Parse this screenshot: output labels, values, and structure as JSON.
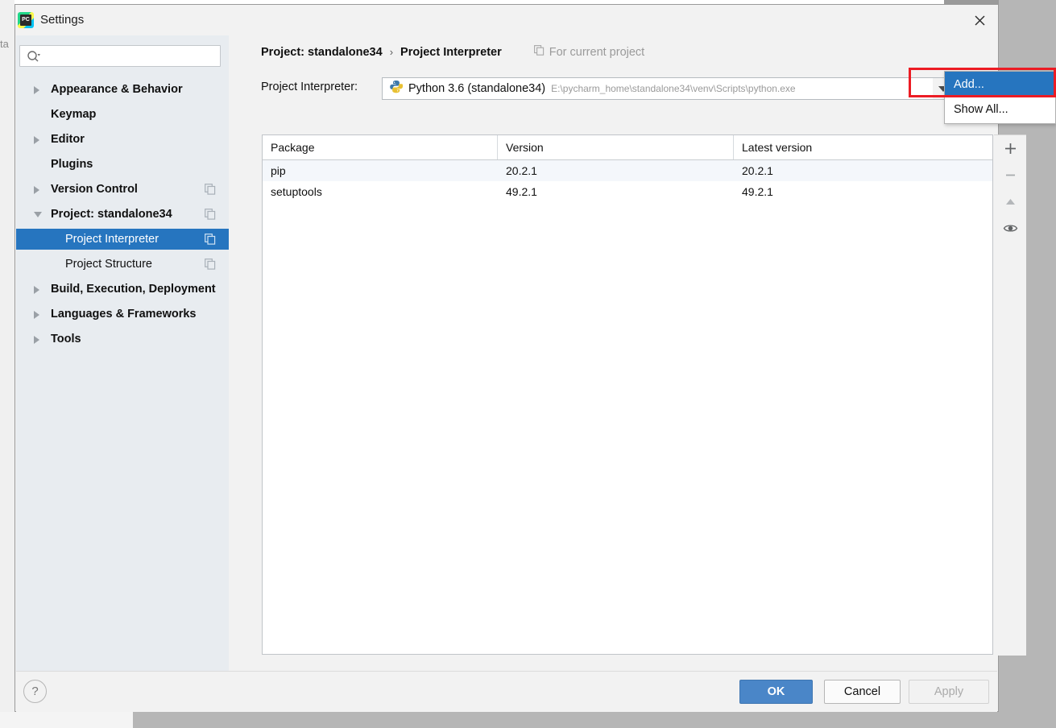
{
  "background": {
    "clipped_text": "ta"
  },
  "window": {
    "title": "Settings",
    "logo_icon": "pycharm-logo-icon",
    "close_icon": "close-icon"
  },
  "sidebar": {
    "search": {
      "placeholder": "",
      "value": "",
      "icon": "search-icon"
    },
    "items": [
      {
        "label": "Appearance & Behavior",
        "level": "top",
        "twisty": "collapsed",
        "selected": false,
        "copy_icon": false
      },
      {
        "label": "Keymap",
        "level": "top",
        "twisty": "none",
        "selected": false,
        "copy_icon": false
      },
      {
        "label": "Editor",
        "level": "top",
        "twisty": "collapsed",
        "selected": false,
        "copy_icon": false
      },
      {
        "label": "Plugins",
        "level": "top",
        "twisty": "none",
        "selected": false,
        "copy_icon": false
      },
      {
        "label": "Version Control",
        "level": "top",
        "twisty": "collapsed",
        "selected": false,
        "copy_icon": true
      },
      {
        "label": "Project: standalone34",
        "level": "top",
        "twisty": "expanded",
        "selected": false,
        "copy_icon": true
      },
      {
        "label": "Project Interpreter",
        "level": "child",
        "twisty": "none",
        "selected": true,
        "copy_icon": true
      },
      {
        "label": "Project Structure",
        "level": "child",
        "twisty": "none",
        "selected": false,
        "copy_icon": true
      },
      {
        "label": "Build, Execution, Deployment",
        "level": "top",
        "twisty": "collapsed",
        "selected": false,
        "copy_icon": false
      },
      {
        "label": "Languages & Frameworks",
        "level": "top",
        "twisty": "collapsed",
        "selected": false,
        "copy_icon": false
      },
      {
        "label": "Tools",
        "level": "top",
        "twisty": "collapsed",
        "selected": false,
        "copy_icon": false
      }
    ]
  },
  "main": {
    "breadcrumb": {
      "parent": "Project: standalone34",
      "separator": "›",
      "current": "Project Interpreter",
      "scope_label": "For current project",
      "scope_icon": "copy-scope-icon"
    },
    "interpreter": {
      "label": "Project Interpreter:",
      "icon": "python-icon",
      "name": "Python 3.6 (standalone34)",
      "path": "E:\\pycharm_home\\standalone34\\venv\\Scripts\\python.exe",
      "dropdown_icon": "chevron-down-icon"
    },
    "packages_table": {
      "columns": [
        "Package",
        "Version",
        "Latest version"
      ],
      "rows": [
        {
          "package": "pip",
          "version": "20.2.1",
          "latest": "20.2.1"
        },
        {
          "package": "setuptools",
          "version": "49.2.1",
          "latest": "49.2.1"
        }
      ]
    },
    "table_tools": [
      {
        "icon": "plus-icon",
        "name": "install-package-button"
      },
      {
        "icon": "minus-icon",
        "name": "uninstall-package-button"
      },
      {
        "icon": "arrow-up-icon",
        "name": "upgrade-package-button"
      },
      {
        "icon": "eye-icon",
        "name": "show-early-releases-button"
      }
    ]
  },
  "popup_menu": {
    "items": [
      {
        "label": "Add...",
        "active": true
      },
      {
        "label": "Show All...",
        "active": false
      }
    ]
  },
  "footer": {
    "help_label": "?",
    "ok_label": "OK",
    "cancel_label": "Cancel",
    "apply_label": "Apply"
  },
  "colors": {
    "accent_blue": "#2675bf",
    "ok_button": "#4a86c8",
    "highlight_red": "#ec1c24",
    "sidebar_bg": "#e8ecf0",
    "dialog_bg": "#f2f2f2"
  }
}
